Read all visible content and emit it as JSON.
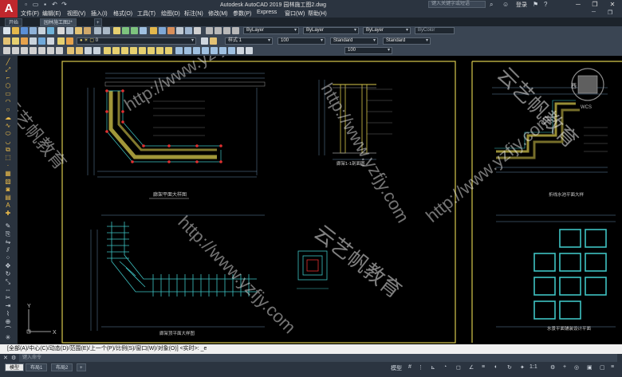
{
  "app": {
    "logo": "A",
    "title": "Autodesk AutoCAD 2019    园林施工图2.dwg",
    "search_placeholder": "键入关键字或短语",
    "login": "登录"
  },
  "window_controls": [
    "─",
    "❐",
    "✕"
  ],
  "menu": [
    "文件(F)",
    "编辑(E)",
    "视图(V)",
    "插入(I)",
    "格式(O)",
    "工具(T)",
    "绘图(D)",
    "标注(N)",
    "修改(M)",
    "参数(P)",
    "Express",
    "窗口(W)",
    "帮助(H)"
  ],
  "file_tabs": [
    "开始",
    "园林施工图2*"
  ],
  "toolbar": {
    "layer_value": "0",
    "color_value": "ByLayer",
    "linetype_value": "ByLayer",
    "lineweight_value": "ByLayer",
    "plotstyle_value": "ByColor",
    "style_value": "样式 1",
    "scale_value": "100",
    "text_style_value": "Standard",
    "dim_style_value": "Standard",
    "scale2_value": "100"
  },
  "drawing": {
    "plan_title": "廊架平面大样图",
    "section_title": "廊架1-1剖面图",
    "top_plan_title": "廊架顶平面大样图",
    "right_plan_title": "折线水池平面大样",
    "right_bottom_title": "水景平面铺装设计平面",
    "viewcube_label": "西",
    "wcs_label": "WCS",
    "watermark_url": "http://www.yzfjy.com",
    "watermark_brand": "云艺帆教育",
    "ucs_y": "Y",
    "ucs_x": "X"
  },
  "command": {
    "history": "[全部(A)/中心(C)/动态(D)/范围(E)/上一个(P)/比例(S)/窗口(W)/对象(O)] <实时>: _e",
    "input_placeholder": "键入命令"
  },
  "status": {
    "tabs": [
      "模型",
      "布局1",
      "布局2"
    ],
    "right_label": "模型",
    "scale": "1:1"
  },
  "colors": {
    "accent": "#c0272d",
    "canvas": "#000000",
    "frame": "#d7c94c",
    "cyan": "#3ec3c3"
  }
}
